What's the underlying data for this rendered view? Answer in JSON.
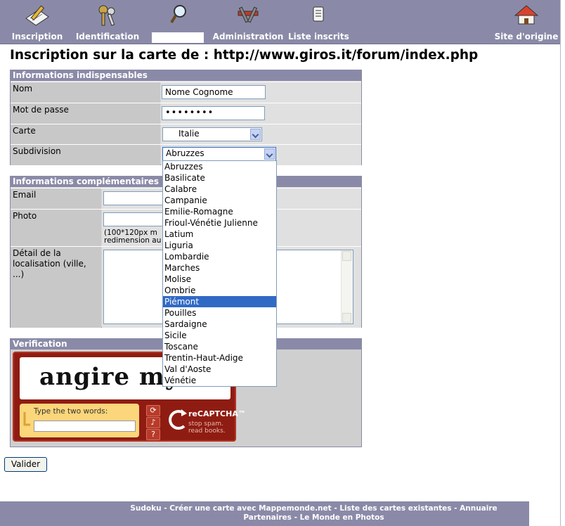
{
  "nav": {
    "items": [
      {
        "label": "Inscription",
        "icon": "pen-paper-icon"
      },
      {
        "label": "Identification",
        "icon": "keys-icon"
      },
      {
        "label": "",
        "icon": "magnifier-icon"
      },
      {
        "label": "Administration",
        "icon": "tools-icon"
      },
      {
        "label": "Liste inscrits",
        "icon": "list-icon"
      },
      {
        "label": "Site d'origine",
        "icon": "home-icon"
      }
    ]
  },
  "page": {
    "title": "Inscription sur la carte de : http://www.giros.it/forum/index.php"
  },
  "section1": {
    "title": "Informations indispensables",
    "nom_label": "Nom",
    "nom_value": "Nome Cognome",
    "pass_label": "Mot de passe",
    "pass_value": "••••••••",
    "carte_label": "Carte",
    "carte_value": "Italie",
    "subdiv_label": "Subdivision",
    "subdiv_value": "Abruzzes"
  },
  "dropdown": {
    "options": [
      "Abruzzes",
      "Basilicate",
      "Calabre",
      "Campanie",
      "Emilie-Romagne",
      "Frioul-Vénétie Julienne",
      "Latium",
      "Liguria",
      "Lombardie",
      "Marches",
      "Molise",
      "Ombrie",
      "Piémont",
      "Pouilles",
      "Sardaigne",
      "Sicile",
      "Toscane",
      "Trentin-Haut-Adige",
      "Val d'Aoste",
      "Vénétie"
    ],
    "selected": "Piémont"
  },
  "section2": {
    "title": "Informations complémentaires",
    "email_label": "Email",
    "photo_label": "Photo",
    "photo_note_1": "(100*120px m",
    "photo_note_2": "redimension au",
    "detail_label": "Détail de la localisation (ville, ...)"
  },
  "section3": {
    "title": "Verification",
    "captcha_words": "angire my",
    "captcha_prompt": "Type the two words:",
    "recaptcha_brand": "reCAPTCHA™",
    "recaptcha_tag_1": "stop spam.",
    "recaptcha_tag_2": "read books."
  },
  "submit_label": "Valider",
  "footer": {
    "line1": "Sudoku - Créer une carte avec Mappemonde.net - Liste des cartes existantes - Annuaire",
    "line2": "Partenaires - Le Monde en Photos"
  },
  "colors": {
    "nav_bg": "#8a8aa8",
    "selection": "#316ac5",
    "captcha_red": "#8f1c12"
  }
}
